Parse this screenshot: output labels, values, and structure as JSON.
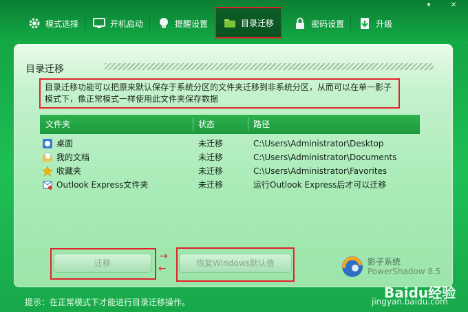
{
  "window": {
    "minimize_label": "▾",
    "close_label": "✕"
  },
  "tabs": [
    {
      "label": "模式选择",
      "icon": "gear-icon"
    },
    {
      "label": "开机启动",
      "icon": "monitor-icon"
    },
    {
      "label": "提醒设置",
      "icon": "bulb-icon"
    },
    {
      "label": "目录迁移",
      "icon": "folder-icon",
      "active": true
    },
    {
      "label": "密码设置",
      "icon": "lock-icon"
    },
    {
      "label": "升级",
      "icon": "upgrade-icon"
    }
  ],
  "panel": {
    "title": "目录迁移",
    "description": "目录迁移功能可以把原来默认保存于系统分区的文件夹迁移到非系统分区，从而可以在单一影子模式下，像正常模式一样使用此文件夹保存数据"
  },
  "table": {
    "columns": [
      "文件夹",
      "状态",
      "路径"
    ],
    "rows": [
      {
        "folder": "桌面",
        "status": "未迁移",
        "path": "C:\\Users\\Administrator\\Desktop",
        "icon": "desktop-icon"
      },
      {
        "folder": "我的文档",
        "status": "未迁移",
        "path": "C:\\Users\\Administrator\\Documents",
        "icon": "documents-icon"
      },
      {
        "folder": "收藏夹",
        "status": "未迁移",
        "path": "C:\\Users\\Administrator\\Favorites",
        "icon": "favorites-star-icon"
      },
      {
        "folder": "Outlook Express文件夹",
        "status": "未迁移",
        "path": "运行Outlook Express后才可以迁移",
        "icon": "outlook-icon"
      }
    ]
  },
  "buttons": {
    "migrate": "迁移",
    "restore": "恢复Windows默认值"
  },
  "logo": {
    "name": "影子系统",
    "product": "PowerShadow",
    "version": "8.5"
  },
  "tip": "提示：在正常模式下才能进行目录迁移操作。",
  "watermark": {
    "brand": "Baidu经验",
    "url": "jingyan.baidu.com"
  },
  "colors": {
    "accent_green": "#13a544",
    "highlight_red": "#e0232b",
    "panel_bg": "#c4f2cc"
  }
}
